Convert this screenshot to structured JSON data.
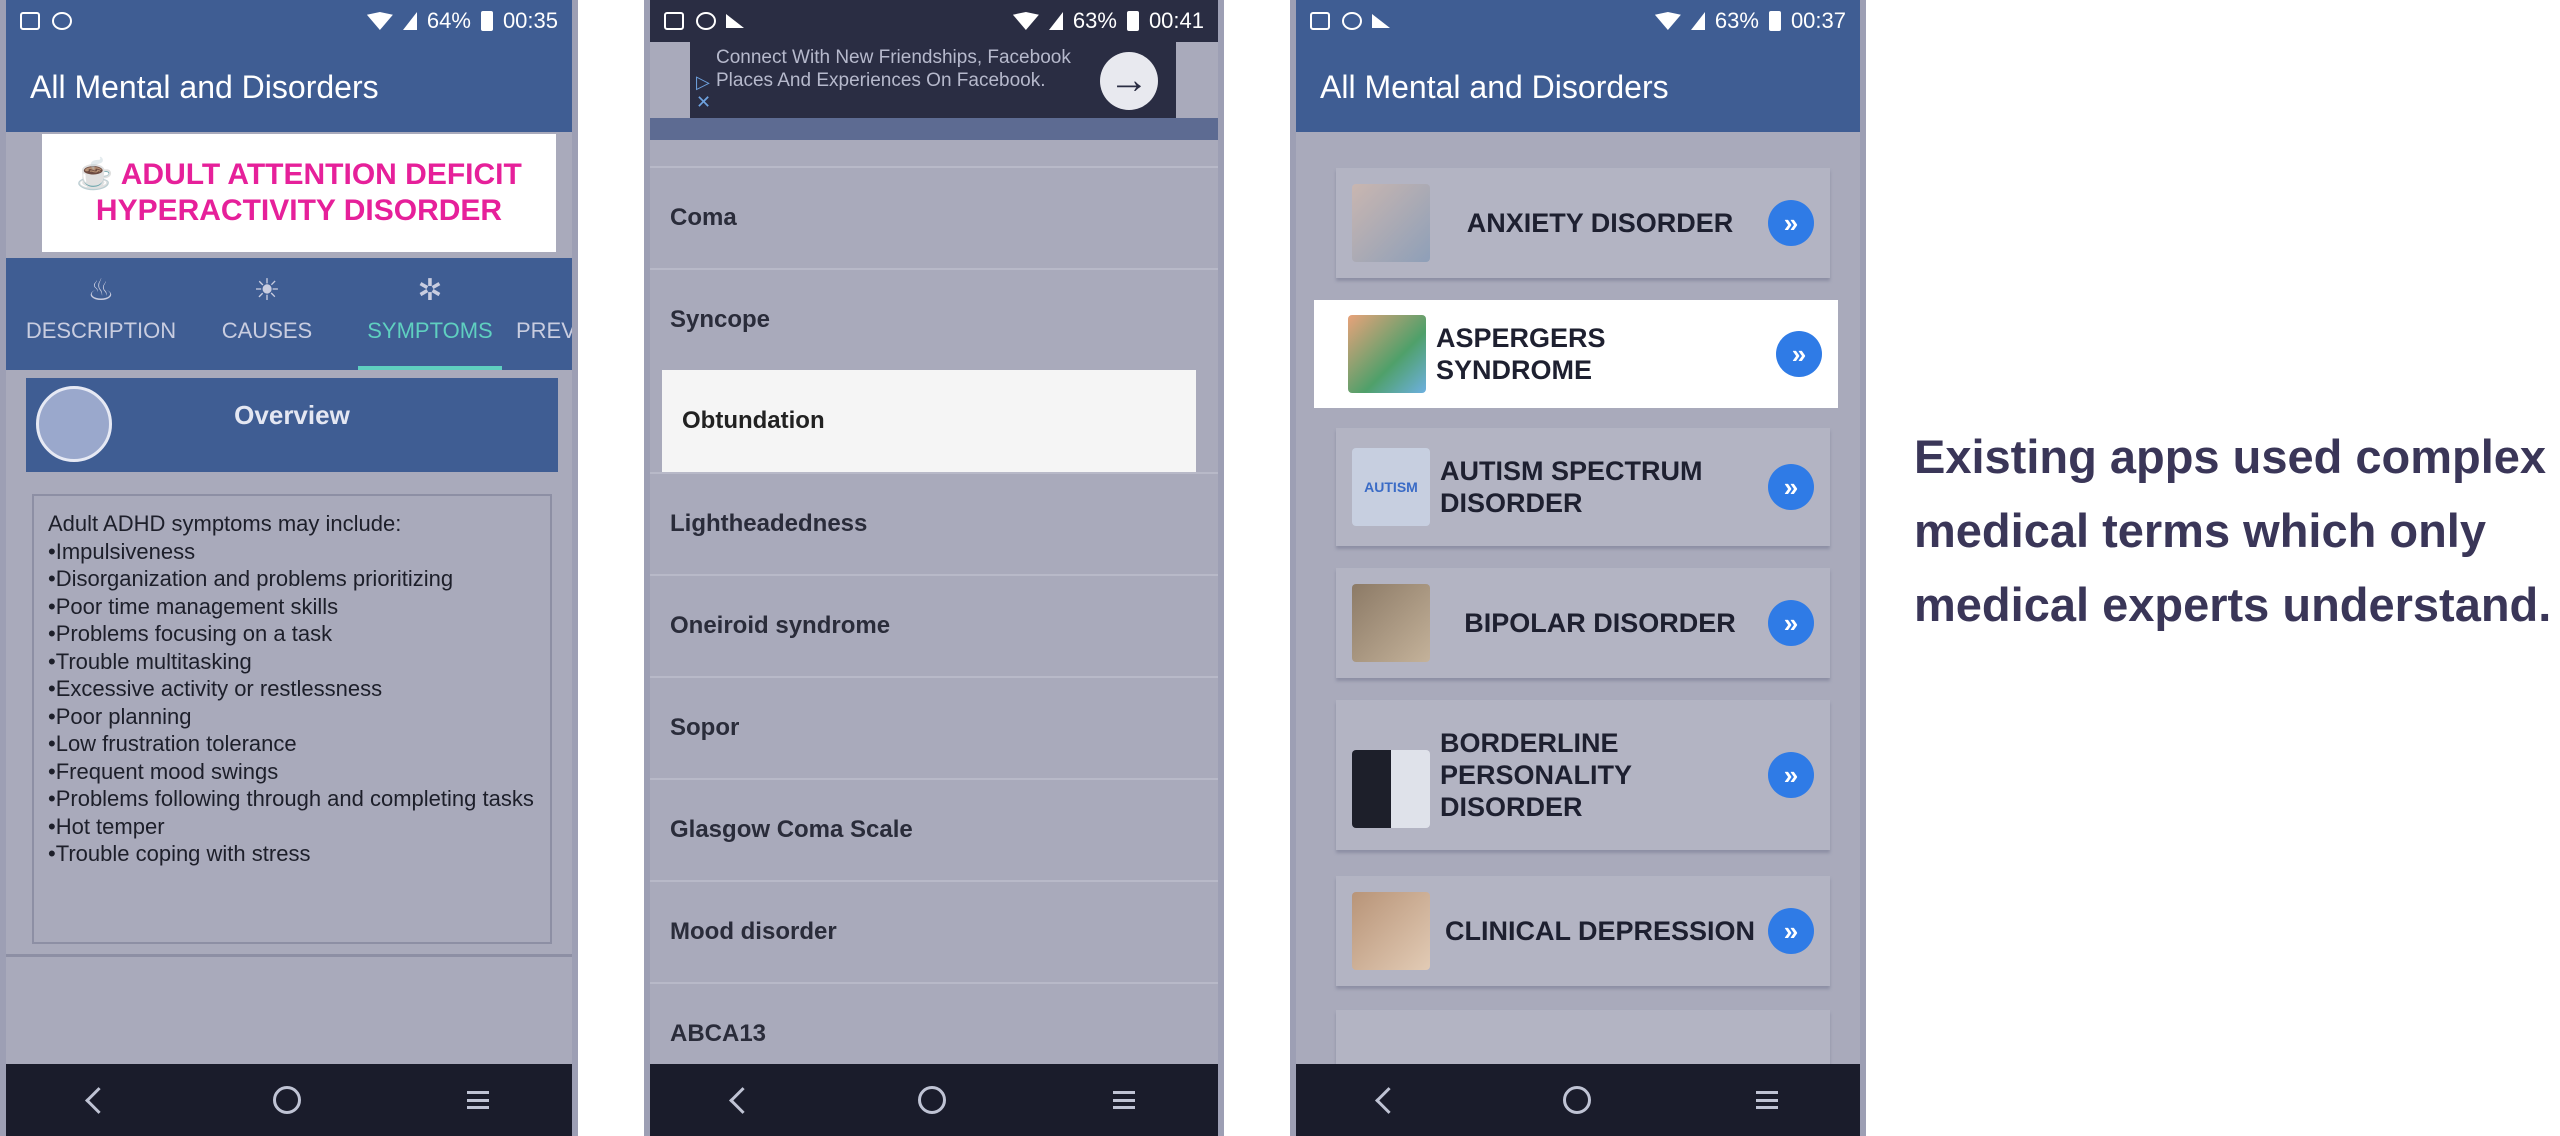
{
  "phone1": {
    "status": {
      "battery": "64%",
      "time": "00:35"
    },
    "appbar_title": "All Mental and Disorders",
    "disorder_title_icon": "☕",
    "disorder_title": "ADULT ATTENTION DEFICIT HYPERACTIVITY DISORDER",
    "tabs": [
      {
        "label": "DESCRIPTION",
        "icon": "flame-icon",
        "glyph": "♨"
      },
      {
        "label": "CAUSES",
        "icon": "bulb-icon",
        "glyph": "☀"
      },
      {
        "label": "SYMPTOMS",
        "icon": "virus-icon",
        "glyph": "✲"
      },
      {
        "label": "PREV",
        "icon": "",
        "glyph": ""
      }
    ],
    "overview_title": "Overview",
    "symptoms_intro": "Adult ADHD symptoms may include:",
    "symptoms": [
      "Impulsiveness",
      "Disorganization and problems prioritizing",
      "Poor time management skills",
      "Problems focusing on a task",
      "Trouble multitasking",
      "Excessive activity or restlessness",
      "Poor planning",
      "Low frustration tolerance",
      "Frequent mood swings",
      "Problems following through and completing tasks",
      "Hot temper",
      "Trouble coping with stress"
    ]
  },
  "phone2": {
    "status": {
      "battery": "63%",
      "time": "00:41"
    },
    "ad_text": "Connect With New Friendships, Facebook Places And Experiences On Facebook.",
    "ad_arrow": "→",
    "terms": [
      "Coma",
      "Syncope",
      "Obtundation",
      "Lightheadedness",
      "Oneiroid syndrome",
      "Sopor",
      "Glasgow Coma Scale",
      "Mood disorder",
      "ABCA13"
    ],
    "highlighted_term_index": 2
  },
  "phone3": {
    "status": {
      "battery": "63%",
      "time": "00:37"
    },
    "appbar_title": "All Mental and Disorders",
    "disorders": [
      "ANXIETY DISORDER",
      "ASPERGERS SYNDROME",
      "AUTISM SPECTRUM DISORDER",
      "BIPOLAR DISORDER",
      "BORDERLINE PERSONALITY DISORDER",
      "CLINICAL DEPRESSION"
    ],
    "go_glyph": "»",
    "thumb_text_autism": "AUTISM",
    "highlighted_disorder_index": 1
  },
  "caption": "Existing apps used complex medical terms which only medical experts understand.",
  "colors": {
    "accent": "#3f5d93",
    "highlight_text": "#e6209a",
    "active_tab": "#5fd0c0",
    "go_button": "#2f7be6"
  }
}
